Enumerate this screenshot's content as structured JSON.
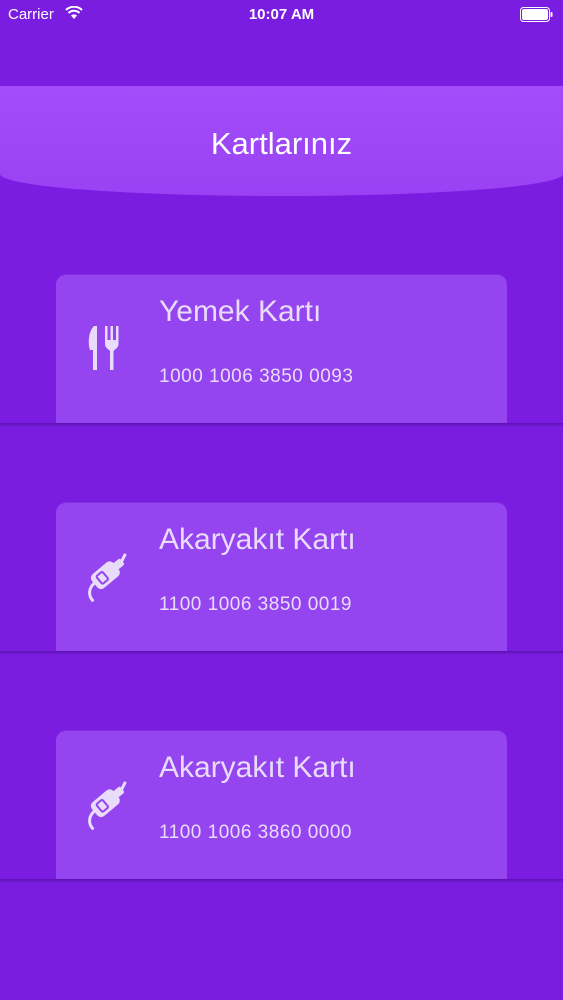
{
  "status_bar": {
    "carrier": "Carrier",
    "time": "10:07 AM"
  },
  "header": {
    "title": "Kartlarınız"
  },
  "colors": {
    "background": "#7a1de0",
    "header": "#a24cfa",
    "card": "#9445ef",
    "card_text": "#e9dcfb"
  },
  "cards": [
    {
      "title": "Yemek Kartı",
      "number": "1000 1006 3850 0093",
      "icon": "fork-knife-icon"
    },
    {
      "title": "Akaryakıt Kartı",
      "number": "1100 1006 3850 0019",
      "icon": "fuel-nozzle-icon"
    },
    {
      "title": "Akaryakıt Kartı",
      "number": "1100 1006 3860 0000",
      "icon": "fuel-nozzle-icon"
    }
  ]
}
